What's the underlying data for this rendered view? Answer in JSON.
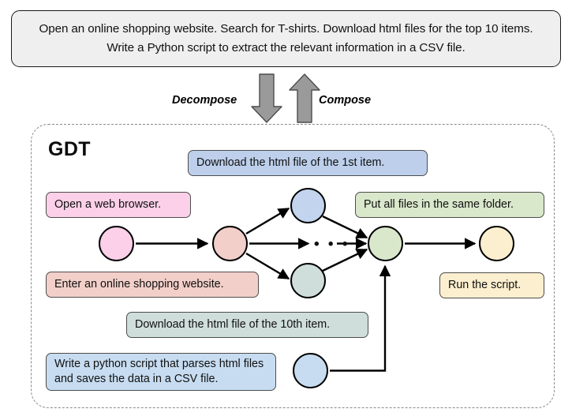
{
  "task": {
    "text": "Open an online shopping website. Search for T-shirts. Download html files for the top 10 items. Write a Python script to extract the relevant information in a CSV file."
  },
  "flow": {
    "decompose_label": "Decompose",
    "compose_label": "Compose",
    "decompose_arrow_direction": "down",
    "compose_arrow_direction": "up",
    "arrow_color": "#9a9a9a"
  },
  "gdt": {
    "title": "GDT",
    "border_style": "dashed",
    "border_color": "#8a8a8a"
  },
  "labels": {
    "open_browser": "Open a web browser.",
    "enter_site": "Enter an online shopping website.",
    "download_first": "Download the html file of the 1st item.",
    "download_tenth": "Download the html file of the 10th item.",
    "put_files": "Put all files in the same folder.",
    "run_script": "Run the script.",
    "write_script": "Write a python script that parses html files and saves the data in a CSV file."
  },
  "nodes": [
    {
      "id": "start",
      "label_ref": "open_browser",
      "color": "#fbd0e8"
    },
    {
      "id": "site",
      "label_ref": "enter_site",
      "color": "#f2cfc9"
    },
    {
      "id": "dl1",
      "label_ref": "download_first",
      "color": "#c2d4ee"
    },
    {
      "id": "dl10",
      "label_ref": "download_tenth",
      "color": "#cfdedb"
    },
    {
      "id": "folder",
      "label_ref": "put_files",
      "color": "#d9e7cb"
    },
    {
      "id": "run",
      "label_ref": "run_script",
      "color": "#fcefcf"
    },
    {
      "id": "py",
      "label_ref": "write_script",
      "color": "#c7dcf0"
    }
  ],
  "ellipsis": "• • •",
  "colors": {
    "task_box_fill": "#efefef",
    "task_box_border": "#1a1a1a",
    "edge_color": "#000000",
    "label_border": "#4d4d4d"
  }
}
